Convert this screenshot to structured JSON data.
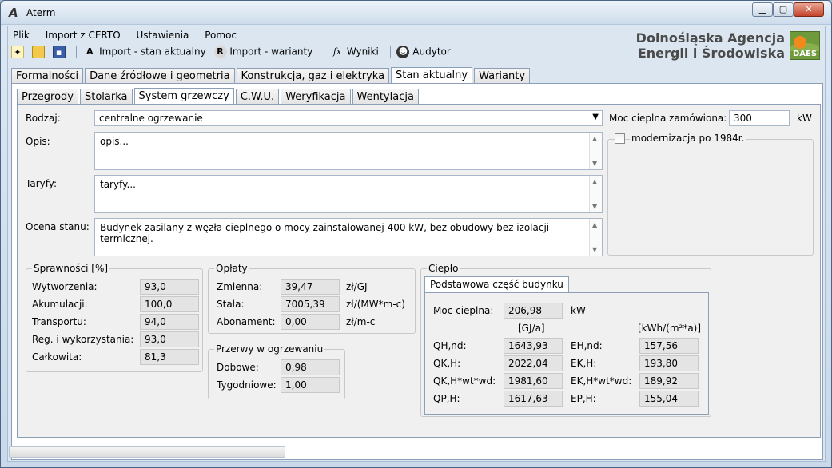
{
  "window": {
    "title": "Aterm",
    "app_icon": "aterm-icon",
    "minimize": "▁",
    "maximize": "▢",
    "close": "✕"
  },
  "menu": [
    "Plik",
    "Import z CERTO",
    "Ustawienia",
    "Pomoc"
  ],
  "toolbar": {
    "import_current": "Import - stan aktualny",
    "import_variants": "Import - warianty",
    "results": "Wyniki",
    "auditor": "Audytor"
  },
  "logo": {
    "line1": "Dolnośląska Agencja",
    "line2": "Energii i Środowiska",
    "mark": "DAES"
  },
  "main_tabs": [
    "Formalności",
    "Dane źródłowe i geometria",
    "Konstrukcja, gaz i elektryka",
    "Stan aktualny",
    "Warianty"
  ],
  "sub_tabs": [
    "Przegrody",
    "Stolarka",
    "System grzewczy",
    "C.W.U.",
    "Weryfikacja",
    "Wentylacja"
  ],
  "form": {
    "rodzaj_label": "Rodzaj:",
    "rodzaj_value": "centralne ogrzewanie",
    "opis_label": "Opis:",
    "opis_value": "opis...",
    "taryfy_label": "Taryfy:",
    "taryfy_value": "taryfy...",
    "ocena_label": "Ocena stanu:",
    "ocena_value": "Budynek zasilany z węzła cieplnego o mocy zainstalowanej 400 kW, bez obudowy bez izolacji termicznej.",
    "moc_label": "Moc cieplna zamówiona:",
    "moc_value": "300",
    "moc_unit": "kW",
    "modernizacja_label": "modernizacja po 1984r."
  },
  "sprawnosci": {
    "title": "Sprawności [%]",
    "rows": [
      {
        "label": "Wytworzenia:",
        "value": "93,0"
      },
      {
        "label": "Akumulacji:",
        "value": "100,0"
      },
      {
        "label": "Transportu:",
        "value": "94,0"
      },
      {
        "label": "Reg. i wykorzystania:",
        "value": "93,0"
      },
      {
        "label": "Całkowita:",
        "value": "81,3"
      }
    ]
  },
  "oplaty": {
    "title": "Opłaty",
    "rows": [
      {
        "label": "Zmienna:",
        "value": "39,47",
        "unit": "zł/GJ"
      },
      {
        "label": "Stała:",
        "value": "7005,39",
        "unit": "zł/(MW*m-c)"
      },
      {
        "label": "Abonament:",
        "value": "0,00",
        "unit": "zł/m-c"
      }
    ]
  },
  "przerwy": {
    "title": "Przerwy w ogrzewaniu",
    "rows": [
      {
        "label": "Dobowe:",
        "value": "0,98"
      },
      {
        "label": "Tygodniowe:",
        "value": "1,00"
      }
    ]
  },
  "cieplo": {
    "title": "Ciepło",
    "tab": "Podstawowa część budynku",
    "moc_label": "Moc cieplna:",
    "moc_value": "206,98",
    "moc_unit": "kW",
    "unit_left": "[GJ/a]",
    "unit_right": "[kWh/(m²*a)]",
    "rows": [
      {
        "label_left": "QH,nd:",
        "value_left": "1643,93",
        "label_right": "EH,nd:",
        "value_right": "157,56"
      },
      {
        "label_left": "QK,H:",
        "value_left": "2022,04",
        "label_right": "EK,H:",
        "value_right": "193,80"
      },
      {
        "label_left": "QK,H*wt*wd:",
        "value_left": "1981,60",
        "label_right": "EK,H*wt*wd:",
        "value_right": "189,92"
      },
      {
        "label_left": "QP,H:",
        "value_left": "1617,63",
        "label_right": "EP,H:",
        "value_right": "155,04"
      }
    ]
  }
}
